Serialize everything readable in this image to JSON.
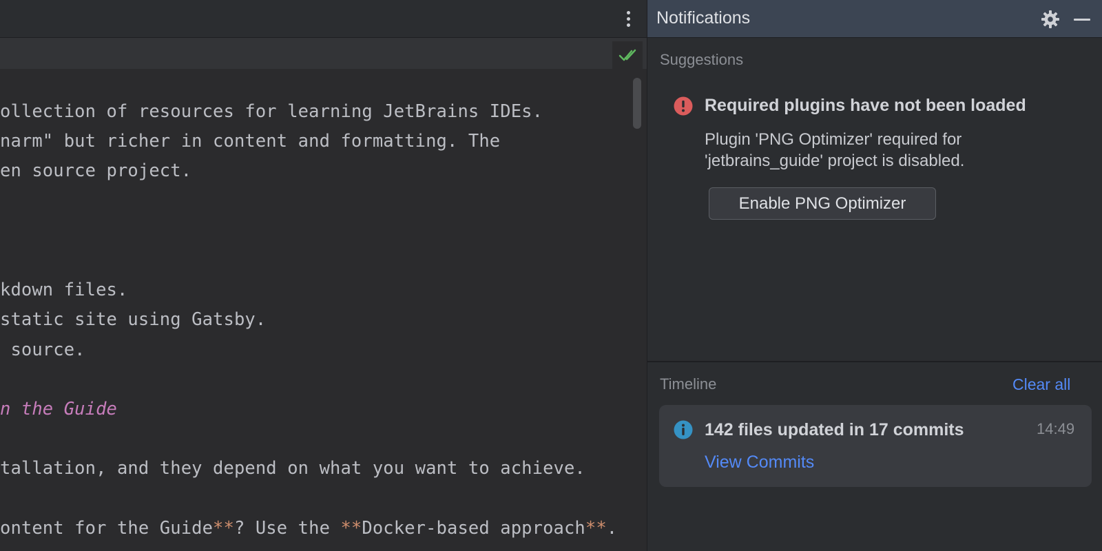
{
  "editor": {
    "lines": [
      {
        "parts": [
          {
            "t": "ollection of resources for learning JetBrains IDEs.",
            "s": "plain"
          }
        ]
      },
      {
        "parts": [
          {
            "t": "narm\" but richer in content and formatting. The",
            "s": "plain"
          }
        ]
      },
      {
        "parts": [
          {
            "t": "en source project.",
            "s": "plain"
          }
        ]
      },
      {
        "parts": []
      },
      {
        "parts": []
      },
      {
        "parts": []
      },
      {
        "parts": [
          {
            "t": "kdown files.",
            "s": "plain"
          }
        ]
      },
      {
        "parts": [
          {
            "t": "static site using Gatsby.",
            "s": "plain"
          }
        ]
      },
      {
        "parts": [
          {
            "t": " source.",
            "s": "plain"
          }
        ]
      },
      {
        "parts": []
      },
      {
        "parts": [
          {
            "t": "n the Guide",
            "s": "italic"
          }
        ]
      },
      {
        "parts": []
      },
      {
        "parts": [
          {
            "t": "tallation, and they depend on what you want to achieve.",
            "s": "plain"
          }
        ]
      },
      {
        "parts": []
      },
      {
        "parts": [
          {
            "t": "ontent for the Guide",
            "s": "plain"
          },
          {
            "t": "**",
            "s": "mark"
          },
          {
            "t": "? Use the ",
            "s": "plain"
          },
          {
            "t": "**",
            "s": "mark"
          },
          {
            "t": "Docker-based approach",
            "s": "plain"
          },
          {
            "t": "**",
            "s": "mark"
          },
          {
            "t": ".",
            "s": "plain"
          }
        ]
      }
    ],
    "colors": {
      "plain": "#bcbec4",
      "italic": "#c77dbb",
      "mark": "#cf8e6d",
      "check": "#5fb85f"
    }
  },
  "panel": {
    "title": "Notifications",
    "suggestions_label": "Suggestions",
    "suggestion": {
      "title": "Required plugins have not been loaded",
      "body_line1": "Plugin 'PNG Optimizer' required for",
      "body_line2": "'jetbrains_guide' project is disabled.",
      "button_label": "Enable PNG Optimizer",
      "icon": "error-icon"
    },
    "timeline_label": "Timeline",
    "clear_all_label": "Clear all",
    "timeline_item": {
      "title": "142 files updated in 17 commits",
      "time": "14:49",
      "link_label": "View Commits",
      "icon": "info-icon"
    },
    "colors": {
      "error": "#db5c5c",
      "info": "#3592c4",
      "link": "#548af7",
      "header": "#3c4553"
    }
  }
}
